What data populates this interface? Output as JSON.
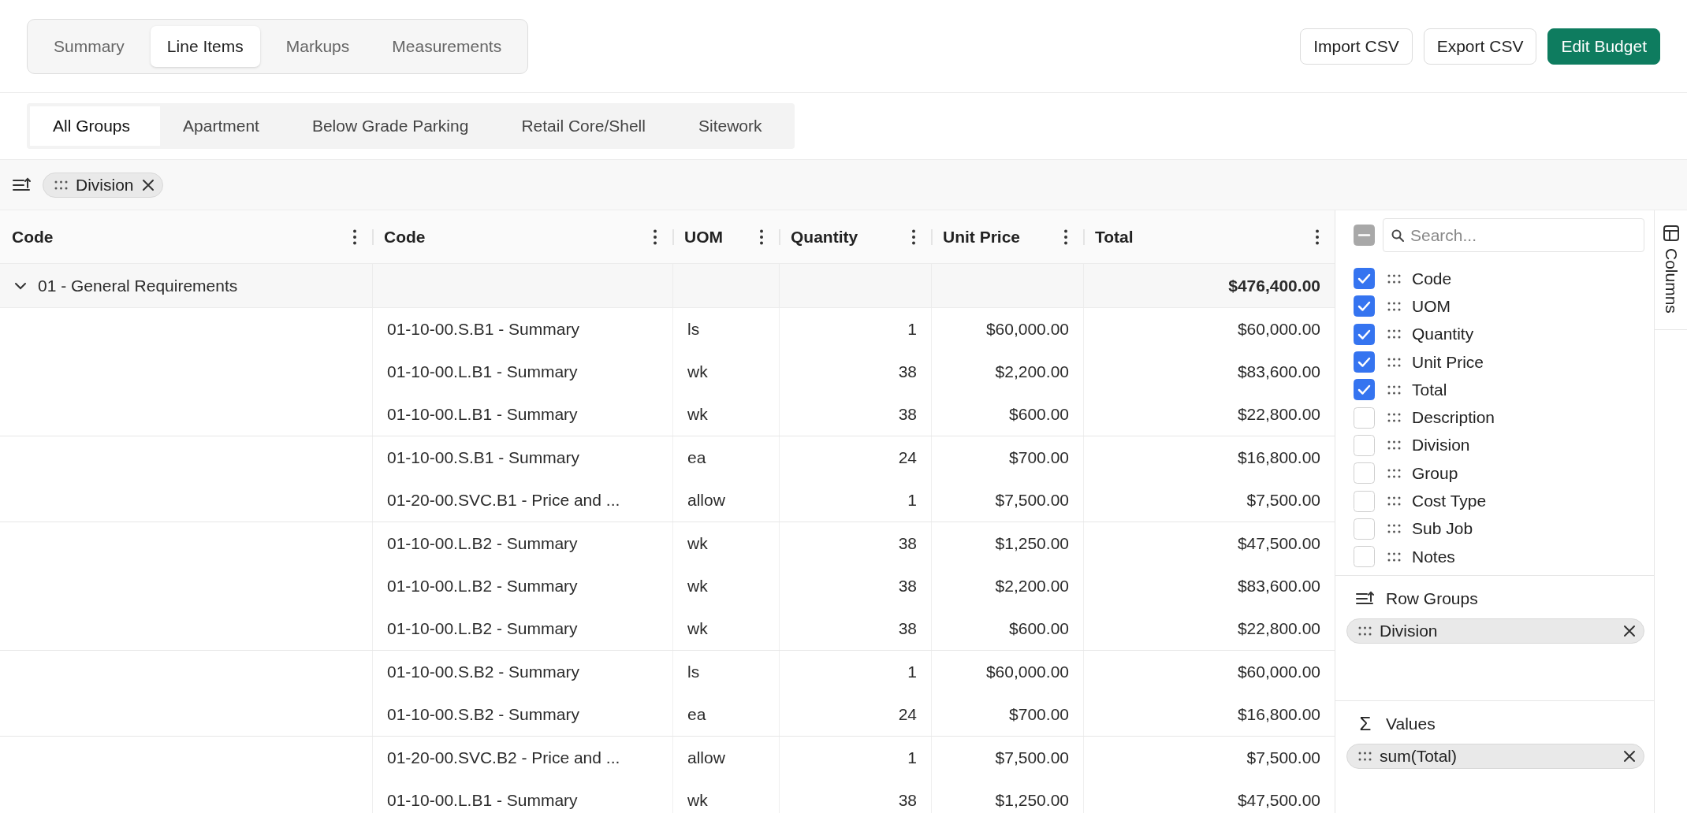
{
  "view_tabs": [
    {
      "label": "Summary",
      "selected": false
    },
    {
      "label": "Line Items",
      "selected": true
    },
    {
      "label": "Markups",
      "selected": false
    },
    {
      "label": "Measurements",
      "selected": false
    }
  ],
  "actions": [
    {
      "label": "Import CSV",
      "kind": "secondary"
    },
    {
      "label": "Export CSV",
      "kind": "secondary"
    },
    {
      "label": "Edit Budget",
      "kind": "primary"
    }
  ],
  "group_tabs": [
    {
      "label": "All Groups",
      "selected": true
    },
    {
      "label": "Apartment",
      "selected": false
    },
    {
      "label": "Below Grade Parking",
      "selected": false
    },
    {
      "label": "Retail Core/Shell",
      "selected": false
    },
    {
      "label": "Sitework",
      "selected": false
    }
  ],
  "row_grouping": {
    "chips": [
      {
        "label": "Division"
      }
    ]
  },
  "table": {
    "columns": [
      {
        "label": "Code"
      },
      {
        "label": "Code"
      },
      {
        "label": "UOM"
      },
      {
        "label": "Quantity"
      },
      {
        "label": "Unit Price"
      },
      {
        "label": "Total"
      }
    ],
    "group_row": {
      "label": "01 - General Requirements",
      "expanded": true,
      "total": "$476,400.00"
    },
    "blocks": [
      {
        "rows": [
          {
            "code": "01-10-00.S.B1 - Summary",
            "uom": "ls",
            "quantity": "1",
            "unit_price": "$60,000.00",
            "total": "$60,000.00"
          },
          {
            "code": "01-10-00.L.B1 - Summary",
            "uom": "wk",
            "quantity": "38",
            "unit_price": "$2,200.00",
            "total": "$83,600.00"
          },
          {
            "code": "01-10-00.L.B1 - Summary",
            "uom": "wk",
            "quantity": "38",
            "unit_price": "$600.00",
            "total": "$22,800.00"
          }
        ]
      },
      {
        "rows": [
          {
            "code": "01-10-00.S.B1 - Summary",
            "uom": "ea",
            "quantity": "24",
            "unit_price": "$700.00",
            "total": "$16,800.00"
          },
          {
            "code": "01-20-00.SVC.B1 - Price and ...",
            "uom": "allow",
            "quantity": "1",
            "unit_price": "$7,500.00",
            "total": "$7,500.00"
          }
        ]
      },
      {
        "rows": [
          {
            "code": "01-10-00.L.B2 - Summary",
            "uom": "wk",
            "quantity": "38",
            "unit_price": "$1,250.00",
            "total": "$47,500.00"
          },
          {
            "code": "01-10-00.L.B2 - Summary",
            "uom": "wk",
            "quantity": "38",
            "unit_price": "$2,200.00",
            "total": "$83,600.00"
          },
          {
            "code": "01-10-00.L.B2 - Summary",
            "uom": "wk",
            "quantity": "38",
            "unit_price": "$600.00",
            "total": "$22,800.00"
          }
        ]
      },
      {
        "rows": [
          {
            "code": "01-10-00.S.B2 - Summary",
            "uom": "ls",
            "quantity": "1",
            "unit_price": "$60,000.00",
            "total": "$60,000.00"
          },
          {
            "code": "01-10-00.S.B2 - Summary",
            "uom": "ea",
            "quantity": "24",
            "unit_price": "$700.00",
            "total": "$16,800.00"
          }
        ]
      },
      {
        "rows": [
          {
            "code": "01-20-00.SVC.B2 - Price and ...",
            "uom": "allow",
            "quantity": "1",
            "unit_price": "$7,500.00",
            "total": "$7,500.00"
          },
          {
            "code": "01-10-00.L.B1 - Summary",
            "uom": "wk",
            "quantity": "38",
            "unit_price": "$1,250.00",
            "total": "$47,500.00"
          }
        ]
      }
    ]
  },
  "column_panel": {
    "select_all": {
      "indeterminate": true
    },
    "search": {
      "placeholder": "Search..."
    },
    "columns": [
      {
        "label": "Code",
        "checked": true
      },
      {
        "label": "UOM",
        "checked": true
      },
      {
        "label": "Quantity",
        "checked": true
      },
      {
        "label": "Unit Price",
        "checked": true
      },
      {
        "label": "Total",
        "checked": true
      },
      {
        "label": "Description",
        "checked": false
      },
      {
        "label": "Division",
        "checked": false
      },
      {
        "label": "Group",
        "checked": false
      },
      {
        "label": "Cost Type",
        "checked": false
      },
      {
        "label": "Sub Job",
        "checked": false
      },
      {
        "label": "Notes",
        "checked": false
      }
    ],
    "row_groups": {
      "title": "Row Groups",
      "chips": [
        {
          "label": "Division"
        }
      ]
    },
    "values": {
      "icon": "Σ",
      "title": "Values",
      "chips": [
        {
          "label": "sum(Total)"
        }
      ]
    }
  },
  "side_tabs": [
    {
      "label": "Columns",
      "selected": true
    }
  ]
}
